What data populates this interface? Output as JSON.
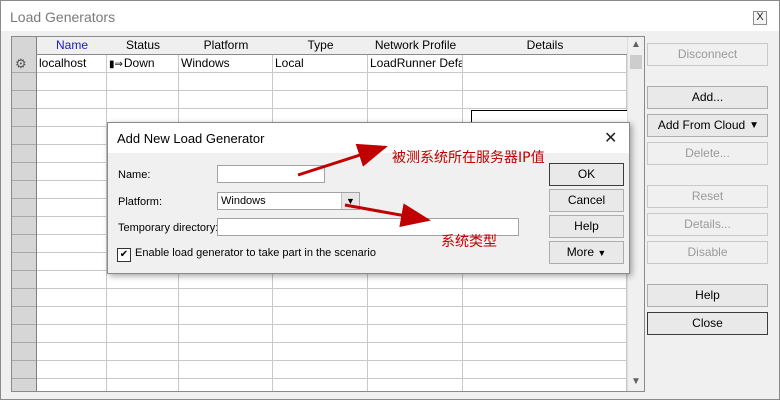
{
  "window": {
    "title": "Load Generators",
    "close_glyph": "X"
  },
  "grid": {
    "columns": [
      "Name",
      "Status",
      "Platform",
      "Type",
      "Network Profile",
      "Details"
    ],
    "rows": [
      {
        "name": "localhost",
        "status": "Down",
        "platform": "Windows",
        "type": "Local",
        "network_profile": "LoadRunner Defaul",
        "details": ""
      }
    ]
  },
  "side_buttons": {
    "disconnect": "Disconnect",
    "add": "Add...",
    "add_from_cloud": "Add From Cloud",
    "delete": "Delete...",
    "reset": "Reset",
    "details": "Details...",
    "disable": "Disable",
    "help": "Help",
    "close": "Close"
  },
  "dialog": {
    "title": "Add New Load Generator",
    "name_label": "Name:",
    "name_value": "",
    "platform_label": "Platform:",
    "platform_value": "Windows",
    "tempdir_label": "Temporary directory:",
    "tempdir_value": "",
    "checkbox_label": "Enable load generator to take part in the scenario",
    "checkbox_checked": true,
    "ok": "OK",
    "cancel": "Cancel",
    "help": "Help",
    "more": "More"
  },
  "annotations": {
    "name_note": "被测系统所在服务器IP值",
    "platform_note": "系统类型",
    "color": "#c00000"
  }
}
